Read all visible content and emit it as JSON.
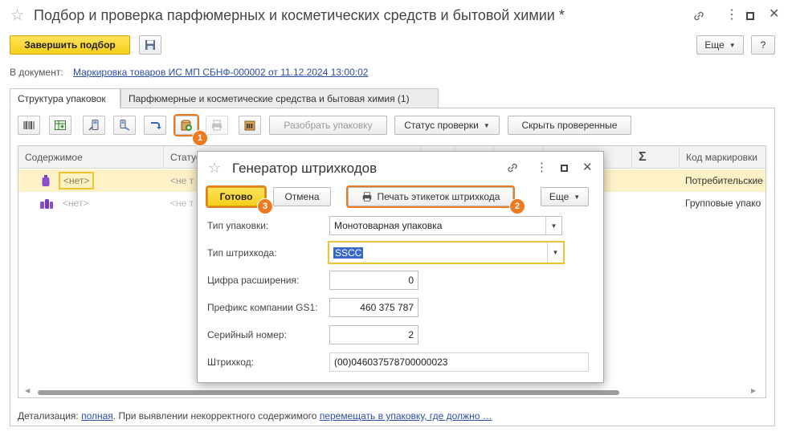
{
  "window": {
    "title": "Подбор и проверка парфюмерных и косметических средств и бытовой химии *"
  },
  "toolbar": {
    "finish_label": "Завершить подбор",
    "more_label": "Еще",
    "help_label": "?"
  },
  "document": {
    "prefix": "В документ:",
    "link": "Маркировка товаров ИС МП СБНФ-000002 от 11.12.2024 13:00:02"
  },
  "tabs": [
    {
      "label": "Структура упаковок"
    },
    {
      "label": "Парфюмерные и косметические средства и бытовая химия (1)"
    }
  ],
  "panel_toolbar": {
    "unpack_label": "Разобрать упаковку",
    "check_status_label": "Статус проверки",
    "hide_checked_label": "Скрыть проверенные"
  },
  "grid": {
    "columns": [
      "Содержимое",
      "Статус",
      "Σ",
      "Код маркировки"
    ],
    "rows": [
      {
        "content": "<нет>",
        "status": "<не т",
        "code": "Потребительские"
      },
      {
        "content": "<нет>",
        "status": "<не т",
        "code": "Групповые упако"
      }
    ]
  },
  "footer": {
    "detail_prefix": "Детализация:",
    "detail_link": "полная",
    "detail_middle": ". При выявлении некорректного содержимого",
    "detail_link2": "перемещать в упаковку, где должно …"
  },
  "dialog": {
    "title": "Генератор штрихкодов",
    "done_label": "Готово",
    "cancel_label": "Отмена",
    "print_label": "Печать этикеток штрихкода",
    "more_label": "Еще",
    "fields": {
      "package_type": {
        "label": "Тип упаковки:",
        "value": "Монотоварная упаковка"
      },
      "barcode_type": {
        "label": "Тип штрихкода:",
        "value": "SSCC"
      },
      "ext_digit": {
        "label": "Цифра расширения:",
        "value": "0"
      },
      "gs1_prefix": {
        "label": "Префикс компании GS1:",
        "value": "460 375 787"
      },
      "serial": {
        "label": "Серийный номер:",
        "value": "2"
      },
      "barcode": {
        "label": "Штрихкод:",
        "value": "(00)046037578700000023"
      }
    }
  },
  "badges": [
    "1",
    "2",
    "3"
  ],
  "colors": {
    "accent_yellow": "#f5cf1a",
    "highlight_orange": "#ec7a20",
    "link_blue": "#2a4fa8",
    "row_highlight": "#fdf1c8"
  }
}
